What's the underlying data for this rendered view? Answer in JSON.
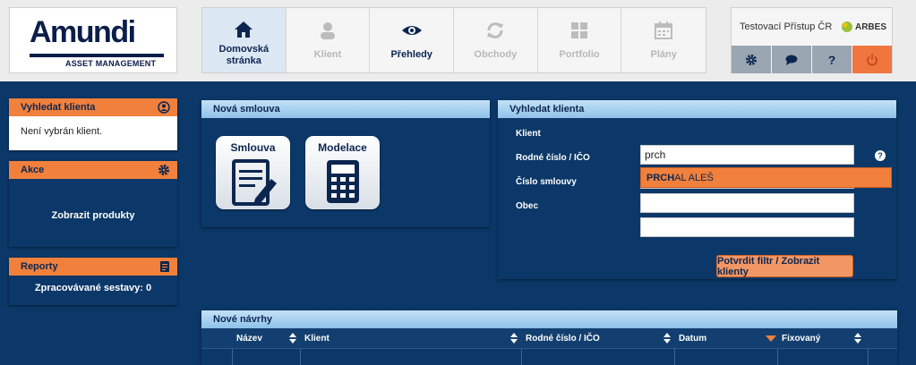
{
  "logo": {
    "name": "Amundi",
    "subtitle": "ASSET MANAGEMENT"
  },
  "nav": [
    {
      "label": "Domovská stránka",
      "icon": "home-icon",
      "active": true
    },
    {
      "label": "Klient",
      "icon": "person-icon"
    },
    {
      "label": "Přehledy",
      "icon": "eye-icon"
    },
    {
      "label": "Obchody",
      "icon": "refresh-icon"
    },
    {
      "label": "Portfolio",
      "icon": "grid-icon"
    },
    {
      "label": "Plány",
      "icon": "calendar-icon"
    }
  ],
  "account": {
    "name": "Testovací Přístup ČR",
    "partner": "ARBES",
    "buttons": [
      {
        "icon": "gear-icon"
      },
      {
        "icon": "chat-icon"
      },
      {
        "icon": "help-icon",
        "label": "?"
      },
      {
        "icon": "power-icon"
      }
    ]
  },
  "sidebar": {
    "search_client": {
      "title": "Vyhledat klienta",
      "text": "Není vybrán klient."
    },
    "actions": {
      "title": "Akce",
      "link": "Zobrazit produkty"
    },
    "reports": {
      "title": "Reporty",
      "text": "Zpracovávané sestavy: 0"
    }
  },
  "new_contract": {
    "title": "Nová smlouva",
    "tiles": [
      {
        "label": "Smlouva",
        "icon": "contract-icon"
      },
      {
        "label": "Modelace",
        "icon": "calculator-icon"
      }
    ]
  },
  "search_form": {
    "title": "Vyhledat klienta",
    "fields": [
      {
        "label": "Klient",
        "value": "prch"
      },
      {
        "label": "Rodné číslo / IČO",
        "value": ""
      },
      {
        "label": "Číslo smlouvy",
        "value": ""
      },
      {
        "label": "Obec",
        "value": ""
      }
    ],
    "suggestion_match": "PRCH",
    "suggestion_rest": "AL ALEŠ",
    "help": "?",
    "confirm_label": "Potvrdit filtr / Zobrazit klienty"
  },
  "drafts": {
    "title": "Nové návrhy",
    "columns": [
      "Název",
      "Klient",
      "Rodné číslo / IČO",
      "Datum",
      "Fixovaný"
    ]
  },
  "colors": {
    "navy": "#0b3868",
    "orange": "#f0803c",
    "light_blue_header": "#8fc2ea",
    "logo_blue": "#0b1e4a"
  }
}
